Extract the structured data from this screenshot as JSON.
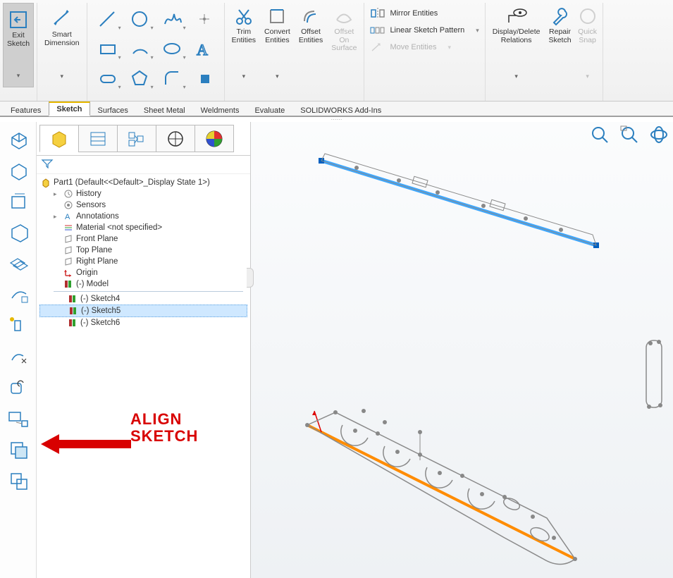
{
  "ribbon": {
    "exit_sketch": "Exit\nSketch",
    "smart_dimension": "Smart\nDimension",
    "trim": "Trim\nEntities",
    "convert": "Convert\nEntities",
    "offset": "Offset\nEntities",
    "offset_surf": "Offset\nOn\nSurface",
    "mirror": "Mirror Entities",
    "linear": "Linear Sketch Pattern",
    "move": "Move Entities",
    "display_rel": "Display/Delete\nRelations",
    "repair": "Repair\nSketch",
    "quick_snap": "Quick\nSnap"
  },
  "tabs": [
    "Features",
    "Sketch",
    "Surfaces",
    "Sheet Metal",
    "Weldments",
    "Evaluate",
    "SOLIDWORKS Add-Ins"
  ],
  "active_tab": "Sketch",
  "tree": {
    "root": "Part1  (Default<<Default>_Display State 1>)",
    "history": "History",
    "sensors": "Sensors",
    "annotations": "Annotations",
    "material": "Material <not specified>",
    "front": "Front Plane",
    "top": "Top Plane",
    "right": "Right Plane",
    "origin": "Origin",
    "model": "(-) Model",
    "sk4": "(-) Sketch4",
    "sk5": "(-) Sketch5",
    "sk6": "(-) Sketch6"
  },
  "annotation": {
    "line1": "ALIGN",
    "line2": "SKETCH"
  }
}
